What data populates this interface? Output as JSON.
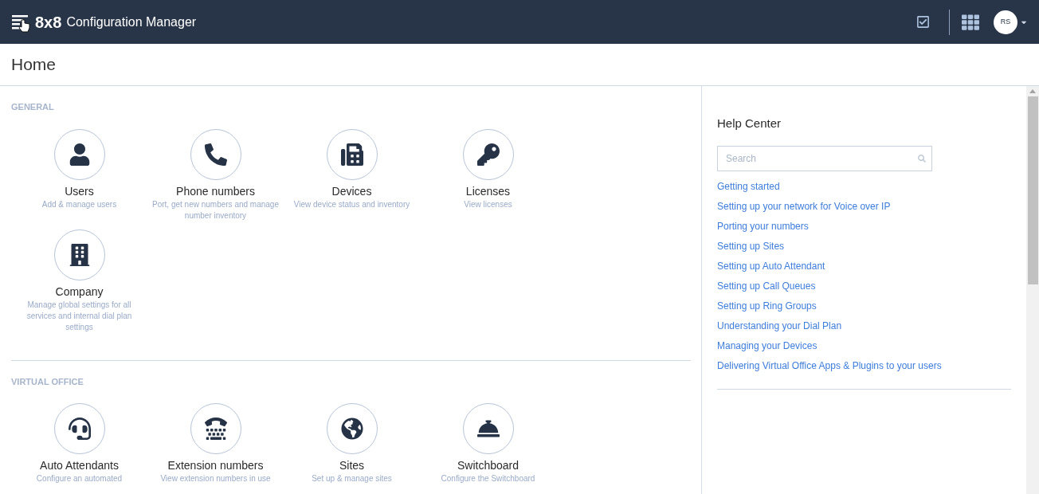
{
  "header": {
    "brand": "8x8",
    "title": "Configuration Manager",
    "avatar": "RS"
  },
  "page": {
    "title": "Home"
  },
  "sections": [
    {
      "title": "GENERAL",
      "tiles": [
        {
          "kind": "user",
          "title": "Users",
          "description": "Add & manage users"
        },
        {
          "kind": "phone",
          "title": "Phone numbers",
          "description": "Port, get new numbers and manage number inventory"
        },
        {
          "kind": "device",
          "title": "Devices",
          "description": "View device status and inventory"
        },
        {
          "kind": "key",
          "title": "Licenses",
          "description": "View licenses"
        },
        {
          "kind": "building",
          "title": "Company",
          "description": "Manage global settings for all services and internal dial plan settings"
        }
      ]
    },
    {
      "title": "VIRTUAL OFFICE",
      "tiles": [
        {
          "kind": "headset",
          "title": "Auto Attendants",
          "description": "Configure an automated"
        },
        {
          "kind": "dialpad",
          "title": "Extension numbers",
          "description": "View extension numbers in use"
        },
        {
          "kind": "globe",
          "title": "Sites",
          "description": "Set up & manage sites"
        },
        {
          "kind": "bell",
          "title": "Switchboard",
          "description": "Configure the Switchboard"
        }
      ]
    }
  ],
  "help_center": {
    "title": "Help Center",
    "search": {
      "placeholder": "Search"
    },
    "links": [
      "Getting started",
      "Setting up your network for Voice over IP",
      "Porting your numbers",
      "Setting up Sites",
      "Setting up Auto Attendant",
      "Setting up Call Queues",
      "Setting up Ring Groups",
      "Understanding your Dial Plan",
      "Managing your Devices",
      "Delivering Virtual Office Apps & Plugins to your users"
    ]
  }
}
